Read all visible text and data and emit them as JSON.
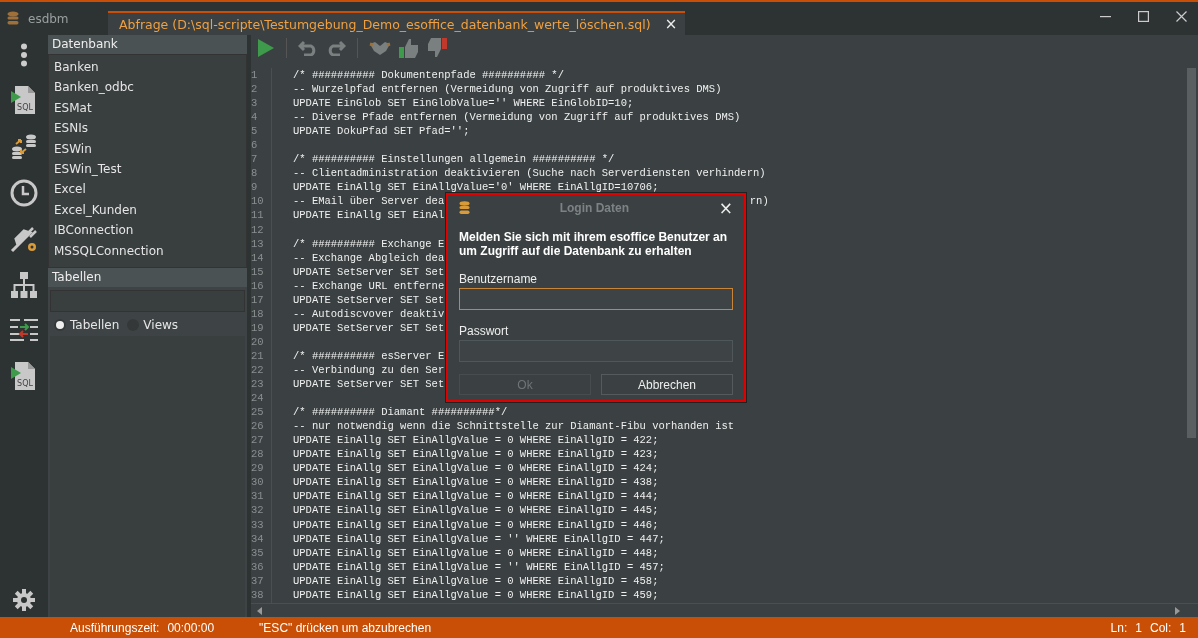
{
  "app": {
    "title": "esdbm"
  },
  "tab": {
    "label": "Abfrage (D:\\sql-scripte\\Testumgebung_Demo_esoffice_datenbank_werte_löschen.sql)",
    "close": "×",
    "selected": true
  },
  "rail": [
    {
      "kind": "dots"
    },
    {
      "kind": "sql",
      "label": "SQL"
    },
    {
      "kind": "sync"
    },
    {
      "kind": "clock"
    },
    {
      "kind": "plug"
    },
    {
      "kind": "tree"
    },
    {
      "kind": "compare"
    },
    {
      "kind": "sql",
      "label": "SQL"
    }
  ],
  "sidebar": {
    "database_header": "Datenbank",
    "databases": [
      {
        "label": "Banken",
        "selected": false
      },
      {
        "label": "Banken_odbc",
        "selected": false
      },
      {
        "label": "ESMat",
        "selected": false
      },
      {
        "label": "ESNIs",
        "selected": false
      },
      {
        "label": "ESWin",
        "selected": false
      },
      {
        "label": "ESWin_Test",
        "selected": false
      },
      {
        "label": "Excel",
        "selected": false
      },
      {
        "label": "Excel_Kunden",
        "selected": false
      },
      {
        "label": "IBConnection",
        "selected": false
      },
      {
        "label": "MSSQLConnection",
        "selected": false
      }
    ],
    "tables_header": "Tabellen",
    "radios": [
      {
        "label": "Tabellen",
        "selected": true
      },
      {
        "label": "Views",
        "selected": false
      }
    ]
  },
  "toolbar": [
    {
      "kind": "run",
      "disabled": false
    },
    {
      "kind": "sep"
    },
    {
      "kind": "undo",
      "disabled": true
    },
    {
      "kind": "redo",
      "disabled": true
    },
    {
      "kind": "sep"
    },
    {
      "kind": "handshake",
      "disabled": true
    },
    {
      "kind": "thumbup",
      "disabled": true
    },
    {
      "kind": "thumbdown",
      "disabled": true
    }
  ],
  "editor": {
    "lines": [
      {
        "n": "1",
        "text": "/* ########## Dokumentenpfade ########## */"
      },
      {
        "n": "2",
        "text": "-- Wurzelpfad entfernen (Vermeidung von Zugriff auf produktives DMS)"
      },
      {
        "n": "3",
        "text": "UPDATE EinGlob SET EinGlobValue='' WHERE EinGlobID=10;"
      },
      {
        "n": "4",
        "text": "-- Diverse Pfade entfernen (Vermeidung von Zugriff auf produktives DMS)"
      },
      {
        "n": "5",
        "text": "UPDATE DokuPfad SET Pfad='';"
      },
      {
        "n": "6"
      },
      {
        "n": "7",
        "text": "/* ########## Einstellungen allgemein ########## */"
      },
      {
        "n": "8",
        "text": "-- Clientadministration deaktivieren (Suche nach Serverdiensten verhindern)"
      },
      {
        "n": "9",
        "text": "UPDATE EinAllg SET EinAllgValue='0' WHERE EinAllgID=10706;"
      },
      {
        "n": "10",
        "text": "-- EMail über Server dea",
        "tail": "rn)"
      },
      {
        "n": "11",
        "text": "UPDATE EinAllg SET EinAl"
      },
      {
        "n": "12"
      },
      {
        "n": "13",
        "text": "/* ########## Exchange E"
      },
      {
        "n": "14",
        "text": "-- Exchange Abgleich dea"
      },
      {
        "n": "15",
        "text": "UPDATE SetServer SET Set"
      },
      {
        "n": "16",
        "text": "-- Exchange URL entferne"
      },
      {
        "n": "17",
        "text": "UPDATE SetServer SET Set"
      },
      {
        "n": "18",
        "text": "-- Autodiscvover deaktiv"
      },
      {
        "n": "19",
        "text": "UPDATE SetServer SET Set"
      },
      {
        "n": "20"
      },
      {
        "n": "21",
        "text": "/* ########## esServer E"
      },
      {
        "n": "22",
        "text": "-- Verbindung zu den Ser"
      },
      {
        "n": "23",
        "text": "UPDATE SetServer SET Set"
      },
      {
        "n": "24"
      },
      {
        "n": "25",
        "text": "/* ########## Diamant ##########*/"
      },
      {
        "n": "26",
        "text": "-- nur notwendig wenn die Schnittstelle zur Diamant-Fibu vorhanden ist"
      },
      {
        "n": "27",
        "text": "UPDATE EinAllg SET EinAllgValue = 0 WHERE EinAllgID = 422;"
      },
      {
        "n": "28",
        "text": "UPDATE EinAllg SET EinAllgValue = 0 WHERE EinAllgID = 423;"
      },
      {
        "n": "29",
        "text": "UPDATE EinAllg SET EinAllgValue = 0 WHERE EinAllgID = 424;"
      },
      {
        "n": "30",
        "text": "UPDATE EinAllg SET EinAllgValue = 0 WHERE EinAllgID = 438;"
      },
      {
        "n": "31",
        "text": "UPDATE EinAllg SET EinAllgValue = 0 WHERE EinAllgID = 444;"
      },
      {
        "n": "32",
        "text": "UPDATE EinAllg SET EinAllgValue = 0 WHERE EinAllgID = 445;"
      },
      {
        "n": "33",
        "text": "UPDATE EinAllg SET EinAllgValue = 0 WHERE EinAllgID = 446;"
      },
      {
        "n": "34",
        "text": "UPDATE EinAllg SET EinAllgValue = '' WHERE EinAllgID = 447;"
      },
      {
        "n": "35",
        "text": "UPDATE EinAllg SET EinAllgValue = 0 WHERE EinAllgID = 448;"
      },
      {
        "n": "36",
        "text": "UPDATE EinAllg SET EinAllgValue = '' WHERE EinAllgID = 457;"
      },
      {
        "n": "37",
        "text": "UPDATE EinAllg SET EinAllgValue = 0 WHERE EinAllgID = 458;"
      },
      {
        "n": "38",
        "text": "UPDATE EinAllg SET EinAllgValue = 0 WHERE EinAllgID = 459;"
      }
    ]
  },
  "dialog": {
    "title": "Login Daten",
    "close": "×",
    "message": "Melden Sie sich mit ihrem esoffice Benutzer an um Zugriff auf die Datenbank zu erhalten",
    "fields": [
      {
        "label": "Benutzername",
        "focused": true
      },
      {
        "label": "Passwort",
        "focused": false
      }
    ],
    "buttons": [
      {
        "label": "Ok",
        "disabled": true
      },
      {
        "label": "Abbrechen",
        "disabled": false
      }
    ]
  },
  "status_bar": {
    "time_label": "Ausführungszeit:",
    "time": "00:00:00",
    "hint": "\"ESC\" drücken um abzubrechen",
    "ln_label": "Ln:",
    "ln": "1",
    "col_label": "Col:",
    "col": "1"
  }
}
